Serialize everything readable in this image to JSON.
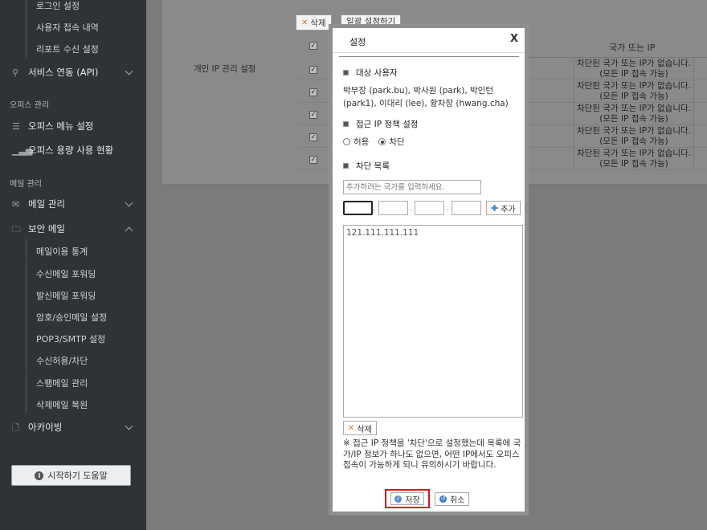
{
  "sidebar": {
    "top_items": [
      {
        "label": "로그인 설정"
      },
      {
        "label": "사용자 접속 내역"
      },
      {
        "label": "리포트 수신 설정"
      }
    ],
    "service_link": {
      "label": "서비스 연동 (API)",
      "icon": "link-icon"
    },
    "office_section": "오피스 관리",
    "office_menu": {
      "label": "오피스 메뉴 설정",
      "icon": "list-icon"
    },
    "office_usage": {
      "label": "오피스 용량 사용 현황",
      "icon": "bar-chart-icon"
    },
    "mail_section": "메일 관리",
    "mail_manage": {
      "label": "메일 관리",
      "icon": "mail-icon"
    },
    "secure_mail": {
      "label": "보안 메일",
      "icon": "secure-folder-icon"
    },
    "secure_items": [
      {
        "label": "메일이용 통계"
      },
      {
        "label": "수신메일 포워딩"
      },
      {
        "label": "발신메일 포워딩"
      },
      {
        "label": "암호/승인메일 설정"
      },
      {
        "label": "POP3/SMTP 설정"
      },
      {
        "label": "수신허용/차단"
      },
      {
        "label": "스팸메일 관리"
      },
      {
        "label": "삭제메일 복원"
      }
    ],
    "archiving": {
      "label": "아카이빙",
      "icon": "archive-icon"
    },
    "help_button": "시작하기 도움말"
  },
  "main": {
    "delete_button": "삭제",
    "bulk_button": "일괄 설정하기",
    "row_label": "개인 IP 관리 설정",
    "column_header": "국가 또는 IP",
    "rows": [
      {
        "text": "차단된 국가 또는 IP가 없습니다.(모든 IP 접속 가능)"
      },
      {
        "text": "차단된 국가 또는 IP가 없습니다.(모든 IP 접속 가능)"
      },
      {
        "text": "차단된 국가 또는 IP가 없습니다.(모든 IP 접속 가능)"
      },
      {
        "text": "차단된 국가 또는 IP가 없습니다.(모든 IP 접속 가능)"
      },
      {
        "text": "차단된 국가 또는 IP가 없습니다.(모든 IP 접속 가능)"
      }
    ]
  },
  "modal": {
    "title": "설정",
    "close": "X",
    "target_heading": "대상 사용자",
    "target_users": "박부장 (park.bu), 박사원 (park), 박인턴 (park1), 이대리 (lee), 황차장 (hwang.cha)",
    "policy_heading": "접근 IP 정책 설정",
    "allow_label": "허용",
    "block_label": "차단",
    "policy_selected": "차단",
    "block_list_heading": "차단 목록",
    "country_placeholder": "추가하려는 국가를 입력하세요.",
    "ip_octets": [
      "",
      "",
      "",
      ""
    ],
    "add_button": "추가",
    "ip_list": [
      "121.111.111.111"
    ],
    "delete_button": "삭제",
    "notice": "※ 접근 IP 정책을 '차단'으로 설정했는데 목록에 국가/IP 정보가 하나도 없으면, 어떤 IP에서도 오피스 접속이 가능하게 되니 유의하시기 바랍니다.",
    "save_button": "저장",
    "cancel_button": "취소"
  },
  "colors": {
    "sidebar_bg": "#2e3338",
    "overlay": "#7b7b7b",
    "highlight": "#e0141c",
    "accent": "#3a86c8"
  }
}
